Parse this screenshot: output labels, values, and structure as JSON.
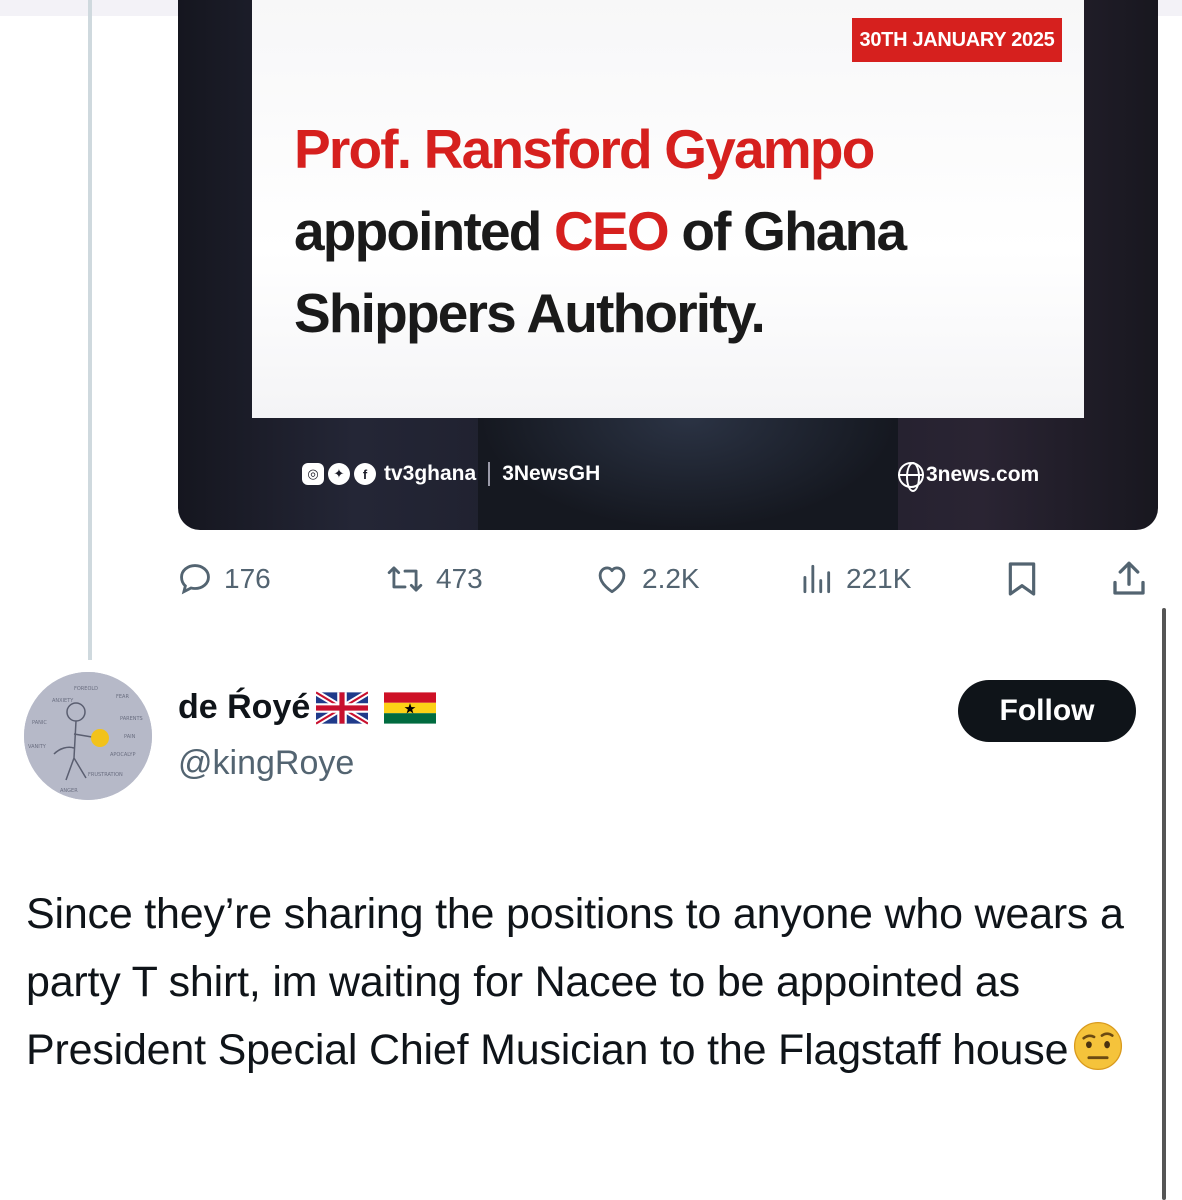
{
  "media": {
    "date_badge": "30TH JANUARY 2025",
    "headline": {
      "line1": "Prof. Ransford Gyampo",
      "line2_pre": "appointed ",
      "line2_red": "CEO",
      "line2_post": " of Ghana",
      "line3": "Shippers Authority."
    },
    "footer_handle": "tv3ghana",
    "footer_brand": "3NewsGH",
    "footer_site": "3news.com",
    "accent_color": "#d6201e"
  },
  "actions": {
    "replies": "176",
    "reposts": "473",
    "likes": "2.2K",
    "views": "221K"
  },
  "reply": {
    "display_name": "de Ŕoyé",
    "flags": [
      "flag-uk-icon",
      "flag-ghana-icon"
    ],
    "handle": "@kingRoye",
    "follow_label": "Follow",
    "text": "Since they’re sharing the positions to anyone who wears a party T shirt, im waiting for Nacee to be appointed as President Special Chief Musician to the Flagstaff house",
    "emoji": "raised-eyebrow-face-icon"
  }
}
